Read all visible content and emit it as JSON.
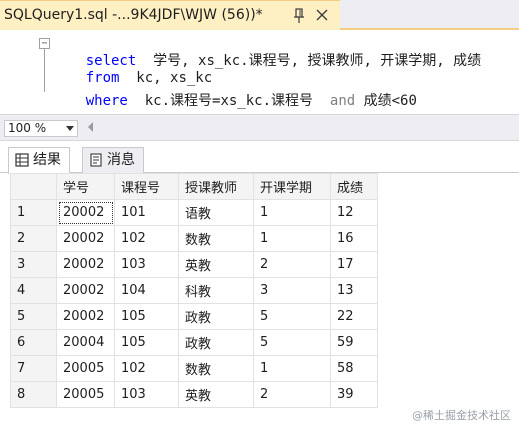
{
  "tab": {
    "title": "SQLQuery1.sql -...9K4JDF\\WJW (56))*"
  },
  "editor": {
    "line1": {
      "kw": "select",
      "text": "  学号, xs_kc.课程号, 授课教师, 开课学期, 成绩"
    },
    "line2": {
      "kw": "from",
      "text": "  kc, xs_kc"
    },
    "line3": {
      "kw": "where",
      "text_a": "  kc.课程号=xs_kc.课程号  ",
      "kw_and": "and",
      "text_b": " 成绩<60"
    }
  },
  "zoom": {
    "value": "100 %"
  },
  "results_tabs": [
    {
      "label": "结果",
      "icon": "grid-icon"
    },
    {
      "label": "消息",
      "icon": "message-icon"
    }
  ],
  "grid": {
    "columns": [
      "学号",
      "课程号",
      "授课教师",
      "开课学期",
      "成绩"
    ],
    "rows": [
      [
        "1",
        "20002",
        "101",
        "语教",
        "1",
        "12"
      ],
      [
        "2",
        "20002",
        "102",
        "数教",
        "1",
        "16"
      ],
      [
        "3",
        "20002",
        "103",
        "英教",
        "2",
        "17"
      ],
      [
        "4",
        "20002",
        "104",
        "科教",
        "3",
        "13"
      ],
      [
        "5",
        "20002",
        "105",
        "政教",
        "5",
        "22"
      ],
      [
        "6",
        "20004",
        "105",
        "政教",
        "5",
        "59"
      ],
      [
        "7",
        "20005",
        "102",
        "数教",
        "1",
        "58"
      ],
      [
        "8",
        "20005",
        "103",
        "英教",
        "2",
        "39"
      ]
    ]
  },
  "watermark": "@稀土掘金技术社区",
  "colors": {
    "keyword": "#0000ff",
    "tab_active": "#fff0c4",
    "tab_border": "#f5cc84"
  }
}
